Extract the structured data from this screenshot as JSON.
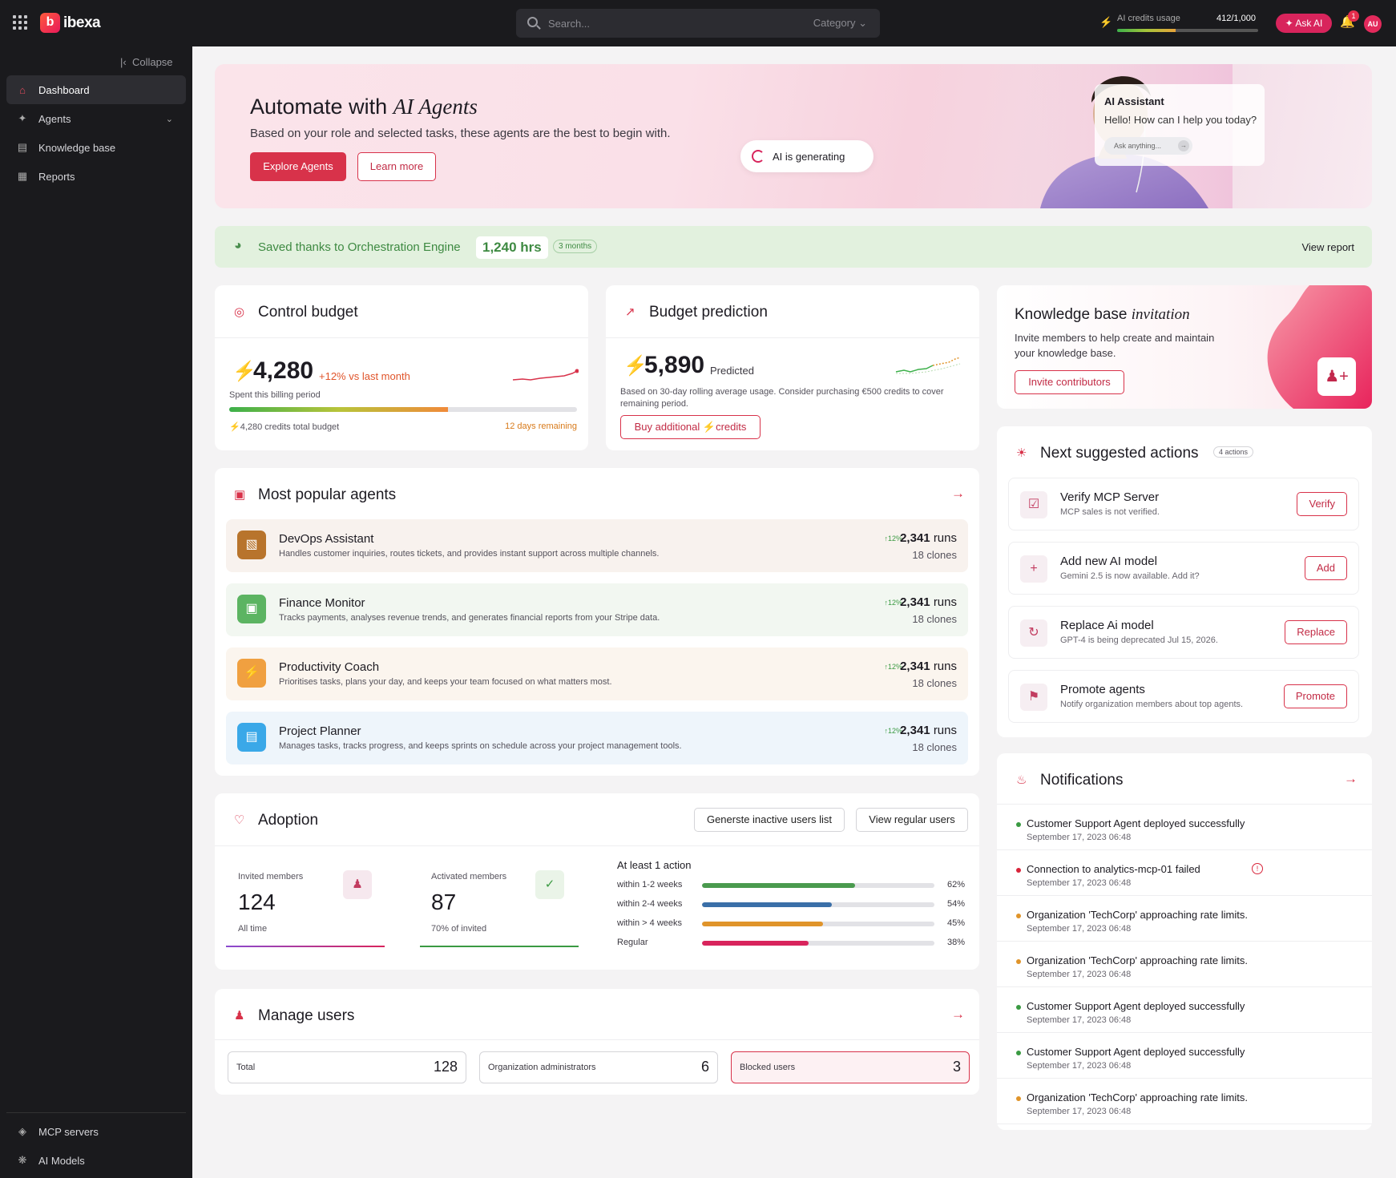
{
  "topbar": {
    "logo_text": "ibexa",
    "search_placeholder": "Search...",
    "category_label": "Category",
    "credits_label": "AI credits usage",
    "credits_value": "412/1,000",
    "credits_used_fraction": 0.412,
    "ask_ai_label": "Ask AI",
    "notification_count": "1",
    "avatar_initials": "AU"
  },
  "sidebar": {
    "collapse_label": "Collapse",
    "items": [
      {
        "label": "Dashboard",
        "icon": "home-icon"
      },
      {
        "label": "Agents",
        "icon": "sparkle-icon"
      },
      {
        "label": "Knowledge base",
        "icon": "book-icon"
      },
      {
        "label": "Reports",
        "icon": "report-icon"
      }
    ],
    "bottom_items": [
      {
        "label": "MCP servers",
        "icon": "server-icon"
      },
      {
        "label": "AI Models",
        "icon": "model-icon"
      }
    ]
  },
  "hero": {
    "title_prefix": "Automate with ",
    "title_script": "AI Agents",
    "subtitle": "Based on your role and selected tasks, these agents are the best to begin with.",
    "explore_label": "Explore Agents",
    "learn_label": "Learn more",
    "generating_label": "AI is generating",
    "assistant_title": "AI Assistant",
    "assistant_greeting": "Hello! How can I help you today?",
    "assistant_placeholder": "Ask anything..."
  },
  "saved": {
    "label": "Saved thanks to Orchestration Engine",
    "hours": "1,240 hrs",
    "period": "3 months",
    "view_label": "View report"
  },
  "control_budget": {
    "title": "Control budget",
    "value": "4,280",
    "change": "+12% vs last month",
    "caption": "Spent this billing period",
    "used_fraction": 0.63,
    "total_label": "4,280 credits total budget",
    "remaining_label": "12 days remaining"
  },
  "budget_prediction": {
    "title": "Budget prediction",
    "value": "5,890",
    "value_suffix": "Predicted",
    "note": "Based on 30-day rolling average usage. Consider purchasing €500 credits to cover remaining period.",
    "buy_label": "Buy additional",
    "buy_suffix": "credits"
  },
  "knowledge_invite": {
    "title_prefix": "Knowledge base ",
    "title_script": "invitation",
    "text": "Invite members to help create and maintain your knowledge base.",
    "button_label": "Invite contributors"
  },
  "popular_agents": {
    "title": "Most popular agents",
    "agents": [
      {
        "name": "DevOps Assistant",
        "desc": "Handles customer inquiries, routes tickets, and provides instant support across multiple channels.",
        "trend": "12%",
        "runs": "2,341",
        "runs_unit": "runs",
        "clones": "18 clones",
        "color": "#b8742c",
        "bg": "#f8f2ee",
        "icon": "document-code-icon"
      },
      {
        "name": "Finance Monitor",
        "desc": "Tracks payments, analyses revenue trends, and generates financial reports from your Stripe data.",
        "trend": "12%",
        "runs": "2,341",
        "runs_unit": "runs",
        "clones": "18 clones",
        "color": "#5cb462",
        "bg": "#f2f7f1",
        "icon": "wallet-icon"
      },
      {
        "name": "Productivity Coach",
        "desc": "Prioritises tasks, plans your day, and keeps your team focused on what matters most.",
        "trend": "12%",
        "runs": "2,341",
        "runs_unit": "runs",
        "clones": "18 clones",
        "color": "#f0a040",
        "bg": "#fbf5ee",
        "icon": "lightning-icon"
      },
      {
        "name": "Project Planner",
        "desc": "Manages tasks, tracks progress, and keeps sprints on schedule across your project management tools.",
        "trend": "12%",
        "runs": "2,341",
        "runs_unit": "runs",
        "clones": "18 clones",
        "color": "#3aa8e8",
        "bg": "#eef5fb",
        "icon": "clipboard-icon"
      }
    ]
  },
  "adoption": {
    "title": "Adoption",
    "generate_label": "Generste inactive users list",
    "view_regular_label": "View regular users",
    "invited": {
      "label": "Invited members",
      "value": "124",
      "caption": "All time"
    },
    "activated": {
      "label": "Activated members",
      "value": "87",
      "caption": "70% of invited"
    },
    "action_title": "At least 1 action",
    "bars": [
      {
        "label": "within 1-2 weeks",
        "percent": "62%",
        "fraction": 0.66,
        "color": "#4a9a4e"
      },
      {
        "label": "within 2-4 weeks",
        "percent": "54%",
        "fraction": 0.56,
        "color": "#3a6fa8"
      },
      {
        "label": "within > 4 weeks",
        "percent": "45%",
        "fraction": 0.52,
        "color": "#e0942a"
      },
      {
        "label": "Regular",
        "percent": "38%",
        "fraction": 0.46,
        "color": "#d8245c"
      }
    ]
  },
  "manage_users": {
    "title": "Manage users",
    "stats": [
      {
        "label": "Total",
        "value": "128"
      },
      {
        "label": "Organization administrators",
        "value": "6"
      },
      {
        "label": "Blocked users",
        "value": "3"
      }
    ]
  },
  "suggested": {
    "title": "Next suggested actions",
    "count": "4 actions",
    "items": [
      {
        "title": "Verify MCP Server",
        "desc": "MCP sales is not verified.",
        "button": "Verify",
        "icon": "verify-document-icon"
      },
      {
        "title": "Add new AI model",
        "desc": "Gemini 2.5 is now available. Add it?",
        "button": "Add",
        "icon": "plus-icon"
      },
      {
        "title": "Replace Ai model",
        "desc": "GPT-4 is being deprecated Jul 15, 2026.",
        "button": "Replace",
        "icon": "refresh-icon"
      },
      {
        "title": "Promote agents",
        "desc": "Notify organization members about top agents.",
        "button": "Promote",
        "icon": "megaphone-icon"
      }
    ]
  },
  "notifications": {
    "title": "Notifications",
    "items": [
      {
        "text": "Customer Support Agent deployed successfully",
        "date": "September 17, 2023 06:48",
        "color": "#3a9a42"
      },
      {
        "text": "Connection to analytics-mcp-01 failed",
        "date": "September 17, 2023 06:48",
        "color": "#d8243a"
      },
      {
        "text": "Organization 'TechCorp' approaching rate limits.",
        "date": "September 17, 2023 06:48",
        "color": "#e0942a"
      },
      {
        "text": "Organization 'TechCorp' approaching rate limits.",
        "date": "September 17, 2023 06:48",
        "color": "#e0942a"
      },
      {
        "text": "Customer Support Agent deployed successfully",
        "date": "September 17, 2023 06:48",
        "color": "#3a9a42"
      },
      {
        "text": "Customer Support Agent deployed successfully",
        "date": "September 17, 2023 06:48",
        "color": "#3a9a42"
      },
      {
        "text": "Organization 'TechCorp' approaching rate limits.",
        "date": "September 17, 2023 06:48",
        "color": "#e0942a"
      }
    ]
  }
}
